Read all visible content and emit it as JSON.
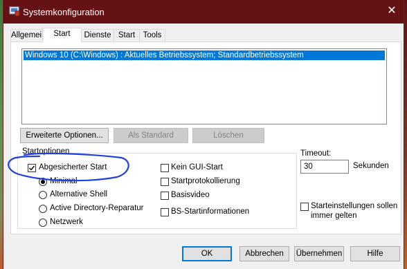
{
  "window": {
    "title": "Systemkonfiguration",
    "close_label": "✕"
  },
  "tabs": [
    "Allgemein",
    "Start",
    "Dienste",
    "Start",
    "Tools"
  ],
  "boot_list": {
    "items": [
      "Windows 10 (C:\\Windows) : Aktuelles Betriebssystem; Standardbetriebssystem"
    ]
  },
  "buttons": {
    "advanced": "Erweiterte Optionen...",
    "set_default": "Als Standard",
    "delete": "Löschen",
    "ok": "OK",
    "cancel": "Abbrechen",
    "apply": "Übernehmen",
    "help": "Hilfe"
  },
  "boot_options": {
    "group_title": "Startoptionen",
    "safe_boot": {
      "label": "Abgesicherter Start",
      "checked": true
    },
    "radios": [
      {
        "label": "Minimal",
        "checked": true
      },
      {
        "label": "Alternative Shell",
        "checked": false
      },
      {
        "label": "Active Directory-Reparatur",
        "checked": false
      },
      {
        "label": "Netzwerk",
        "checked": false
      }
    ],
    "checkboxes": [
      {
        "label": "Kein GUI-Start",
        "checked": false
      },
      {
        "label": "Startprotokollierung",
        "checked": false
      },
      {
        "label": "Basisvideo",
        "checked": false
      },
      {
        "label": "BS-Startinformationen",
        "checked": false
      }
    ]
  },
  "timeout": {
    "label": "Timeout:",
    "value": "30",
    "unit": "Sekunden"
  },
  "permanent": {
    "label_line1": "Starteinstellungen sollen",
    "label_line2": "immer gelten",
    "checked": false
  },
  "colors": {
    "titlebar": "#641214",
    "selection": "#0078d7",
    "annotation": "#1f3fe0"
  },
  "icons": [
    "app-icon",
    "close-icon",
    "checkmark-icon"
  ]
}
